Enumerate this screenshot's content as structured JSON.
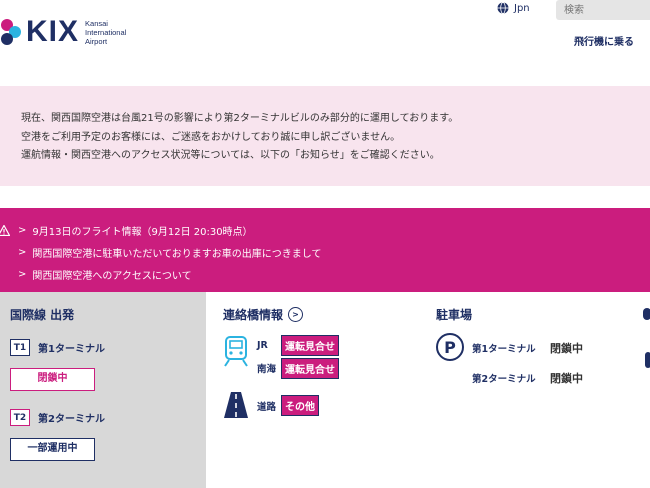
{
  "header": {
    "logo_text": "KIX",
    "logo_sub": [
      "Kansai",
      "International",
      "Airport"
    ],
    "language": "Jpn",
    "search_placeholder": "検索",
    "fly_link": "飛行機に乗る"
  },
  "notice": {
    "lines": [
      "現在、関西国際空港は台風21号の影響により第2ターミナルビルのみ部分的に運用しております。",
      "空港をご利用予定のお客様には、ご迷惑をおかけしており誠に申し訳ございません。",
      "運航情報・関西空港へのアクセス状況等については、以下の「お知らせ」をご確認ください。"
    ]
  },
  "flight_info": {
    "items": [
      "9月13日のフライト情報（9月12日 20:30時点）",
      "関西国際空港に駐車いただいておりますお車の出庫につきまして",
      "関西国際空港へのアクセスについて"
    ]
  },
  "departures": {
    "title": "国際線 出発",
    "terminals": [
      {
        "badge": "T1",
        "name": "第1ターミナル",
        "status": "閉鎖中"
      },
      {
        "badge": "T2",
        "name": "第2ターミナル",
        "status": "一部運用中"
      }
    ]
  },
  "access": {
    "title": "連絡橋情報",
    "rail": [
      {
        "label": "JR",
        "status": "運転見合せ"
      },
      {
        "label": "南海",
        "status": "運転見合せ"
      }
    ],
    "road": {
      "label": "道路",
      "status": "その他"
    }
  },
  "parking": {
    "title": "駐車場",
    "icon_letter": "P",
    "rows": [
      {
        "name": "第1ターミナル",
        "status": "閉鎖中"
      },
      {
        "name": "第2ターミナル",
        "status": "閉鎖中"
      }
    ]
  }
}
